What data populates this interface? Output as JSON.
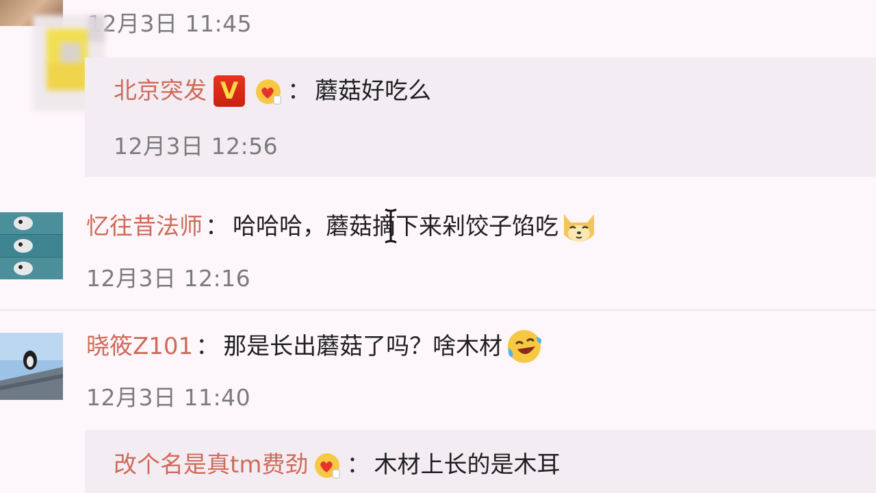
{
  "comments": [
    {
      "timestamp": "12月3日 11:45"
    },
    {
      "reply": true,
      "username": "北京突发",
      "colon": "：",
      "badge_v": "V",
      "content": "蘑菇好吃么",
      "timestamp": "12月3日 12:56"
    },
    {
      "username": "忆往昔法师",
      "colon": "：",
      "content": "哈哈哈，蘑菇摘下来剁饺子馅吃",
      "emoji": "doge-icon",
      "timestamp": "12月3日 12:16"
    },
    {
      "username": "晓筱Z101",
      "colon": "：",
      "content": "那是长出蘑菇了吗？啥木材",
      "emoji": "laugh-cry-icon",
      "timestamp": "12月3日 11:40"
    },
    {
      "reply": true,
      "username": "改个名是真tm费劲",
      "colon": "：",
      "content": "木材上长的是木耳"
    }
  ],
  "colors": {
    "background": "#fdf6fb",
    "reply_background": "#f3edf3",
    "username": "#cf6a58",
    "timestamp": "#7b7b7b",
    "v_badge": "#d9291a"
  }
}
